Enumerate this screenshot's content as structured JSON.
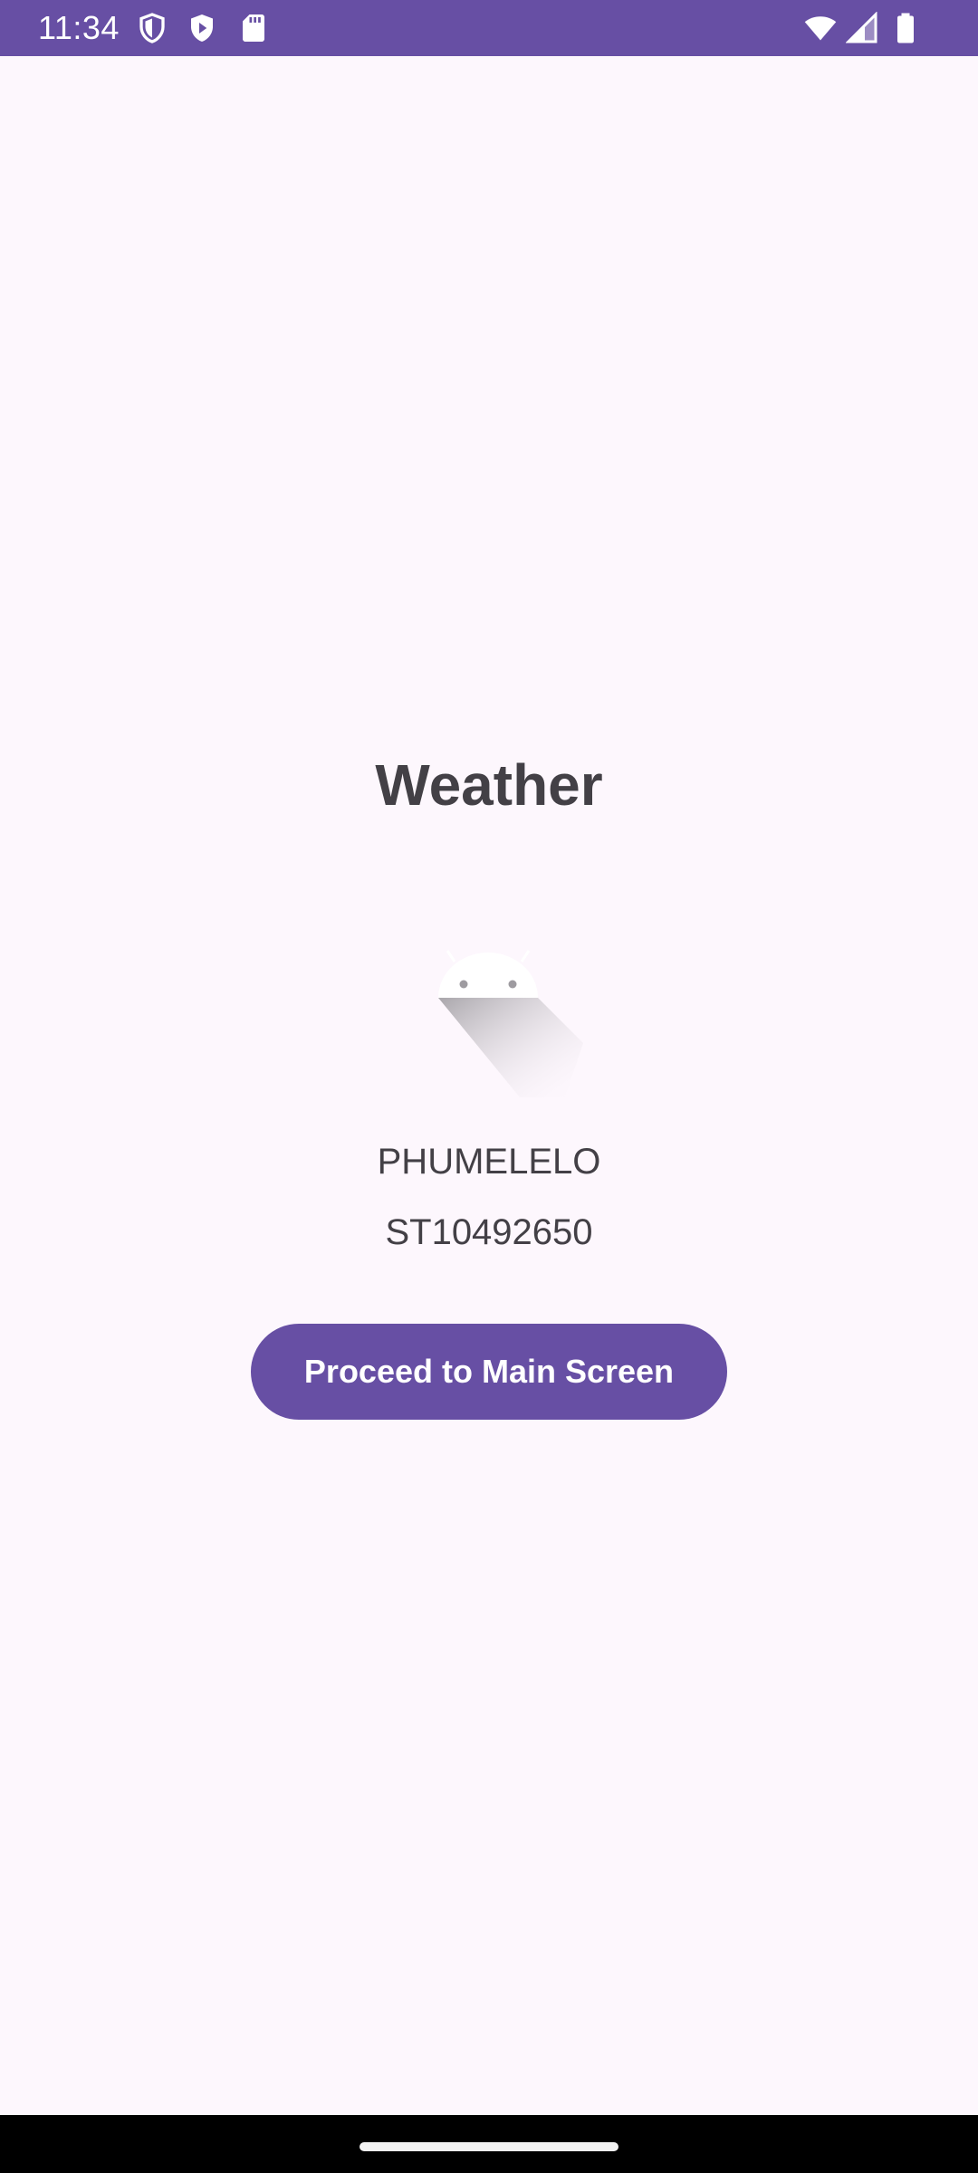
{
  "status_bar": {
    "time": "11:34",
    "background": "#674fa4",
    "icons_left": [
      "shield-icon",
      "play-protect-icon",
      "sd-card-icon"
    ],
    "icons_right": [
      "wifi-icon",
      "cell-signal-icon",
      "battery-icon"
    ]
  },
  "main": {
    "title": "Weather",
    "logo": "android-logo-icon",
    "name": "PHUMELELO",
    "student_id": "ST10492650",
    "proceed_button_label": "Proceed to Main Screen"
  },
  "colors": {
    "accent": "#674fa4",
    "background": "#fdf7fd",
    "text": "#434046"
  }
}
